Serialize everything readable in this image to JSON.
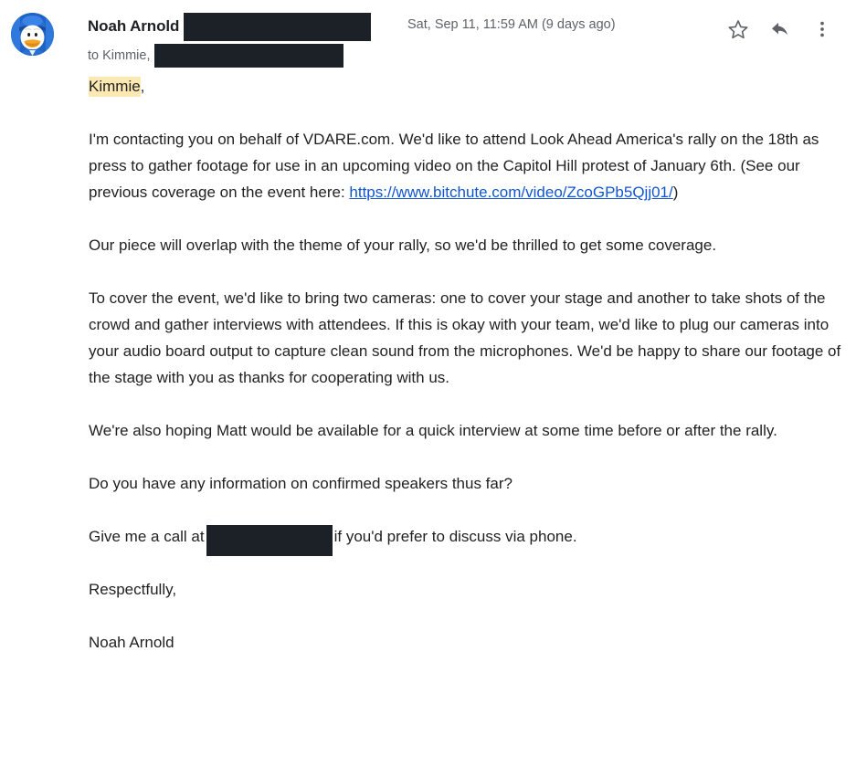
{
  "header": {
    "sender_name": "Noah Arnold",
    "sender_email_redacted": "[redacted]",
    "date": "Sat, Sep 11, 11:59 AM (9 days ago)",
    "recipient_prefix": "to Kimmie,",
    "recipient_redacted": "[redacted]",
    "actions": [
      {
        "name": "star-icon",
        "label": "Star"
      },
      {
        "name": "reply-icon",
        "label": "Reply"
      },
      {
        "name": "more-vertical-icon",
        "label": "More"
      }
    ],
    "avatar": {
      "name": "avatar",
      "alt": "Donald Duck profile picture",
      "colors": {
        "hat": "#2a6fd4",
        "hat_dark": "#1a4c9e",
        "face": "#fdfdfd",
        "beak": "#f5a623",
        "background": "#1f63c4"
      }
    }
  },
  "body": {
    "greeting_highlighted": "Kimmie",
    "greeting_rest": ",",
    "paragraph_1_before_link": "I'm contacting you on behalf of VDARE.com. We'd like to attend Look Ahead America's rally on the 18th as press to gather footage for use in an upcoming video on the Capitol Hill protest of January 6th. (See our previous coverage on the event here: ",
    "link_text": "https://www.bitchute.com/video/ZcoGPb5Qjj01/",
    "link_href": "https://www.bitchute.com/video/ZcoGPb5Qjj01/",
    "paragraph_1_after_link": ")",
    "paragraph_2": "Our piece will overlap with the theme of your rally, so we'd be thrilled to get some coverage.",
    "paragraph_3": "To cover the event, we'd like to bring two cameras: one to cover your stage and another to take shots of the crowd and gather interviews with attendees. If this is okay with your team, we'd like to plug our cameras into your audio board output to capture clean sound from the microphones. We'd be happy to share our footage of the stage with you as thanks for cooperating with us.",
    "paragraph_4": "We're also hoping Matt would be available for a quick interview at some time before or after the rally.",
    "paragraph_5": "Do you have any information on confirmed speakers thus far?",
    "paragraph_6_before_redaction": "Give me a call at",
    "phone_redacted": "[redacted]",
    "paragraph_6_after_redaction": "if you'd prefer to discuss via phone.",
    "closing": "Respectfully,",
    "signature": "Noah Arnold"
  },
  "colors": {
    "text": "#222222",
    "meta_text": "#5f6368",
    "sender_text": "#202124",
    "link": "#1155cc",
    "highlight": "#fce8b2",
    "redaction": "#1c2128",
    "icon": "#5f6368",
    "background": "#ffffff"
  }
}
